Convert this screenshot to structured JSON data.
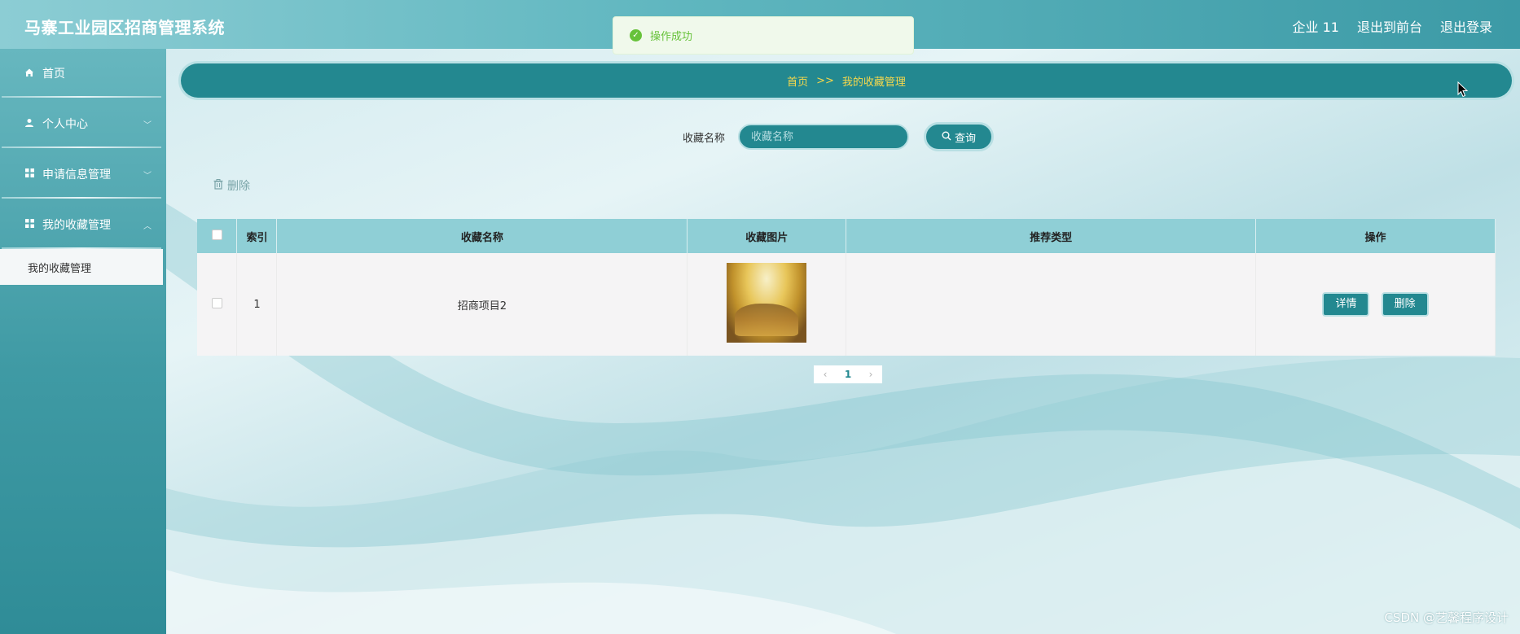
{
  "header": {
    "title": "马寨工业园区招商管理系统",
    "links": [
      "企业 11",
      "退出到前台",
      "退出登录"
    ]
  },
  "toast": {
    "message": "操作成功"
  },
  "sidebar": {
    "items": [
      {
        "label": "首页",
        "icon": "home-icon"
      },
      {
        "label": "个人中心",
        "icon": "user-icon"
      },
      {
        "label": "申请信息管理",
        "icon": "grid-icon"
      },
      {
        "label": "我的收藏管理",
        "icon": "grid-icon"
      }
    ],
    "active_sub": "我的收藏管理"
  },
  "breadcrumb": {
    "home": "首页",
    "separator": ">>",
    "current": "我的收藏管理"
  },
  "search": {
    "label": "收藏名称",
    "placeholder": "收藏名称",
    "button": "查询"
  },
  "toolbar": {
    "delete_label": "删除"
  },
  "table": {
    "headers": [
      "索引",
      "收藏名称",
      "收藏图片",
      "推荐类型",
      "操作"
    ],
    "rows": [
      {
        "index": "1",
        "name": "招商项目2",
        "type": "",
        "detail": "详情",
        "delete": "删除"
      }
    ]
  },
  "pager": {
    "prev": "‹",
    "current": "1",
    "next": "›"
  },
  "watermark": "CSDN @艺馨程序设计",
  "colors": {
    "accent": "#238890",
    "header": "#5fb6bf",
    "breadcrumb_text": "#f7d84b",
    "success": "#67c23a"
  }
}
